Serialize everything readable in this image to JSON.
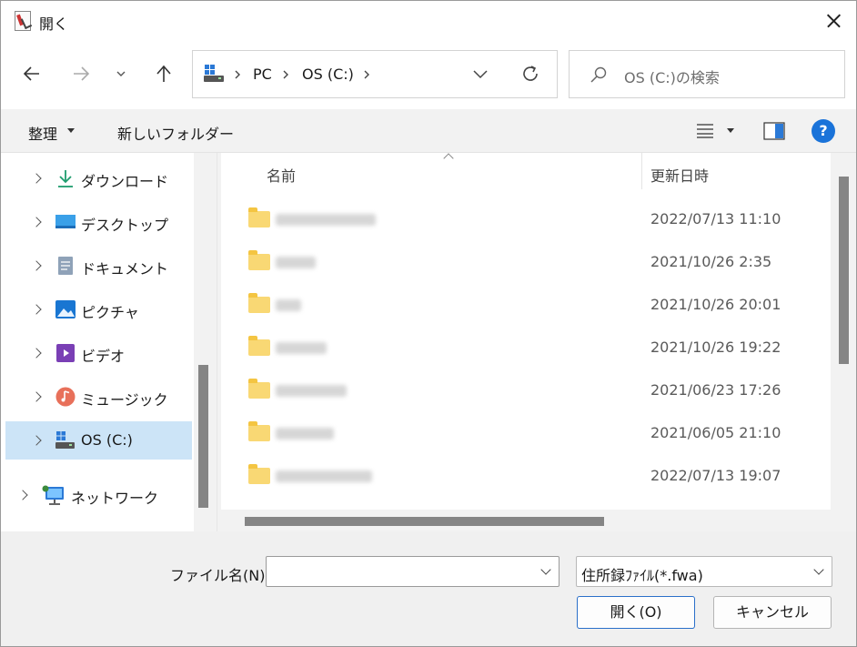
{
  "window": {
    "title": "開く"
  },
  "address": {
    "crumbs": [
      "PC",
      "OS (C:)"
    ]
  },
  "search": {
    "placeholder": "OS (C:)の検索"
  },
  "commands": {
    "organize": "整理",
    "new_folder": "新しいフォルダー"
  },
  "nav_pane": {
    "items": [
      {
        "label": "ダウンロード",
        "icon": "download-icon"
      },
      {
        "label": "デスクトップ",
        "icon": "desktop-icon"
      },
      {
        "label": "ドキュメント",
        "icon": "documents-icon"
      },
      {
        "label": "ピクチャ",
        "icon": "pictures-icon"
      },
      {
        "label": "ビデオ",
        "icon": "videos-icon"
      },
      {
        "label": "ミュージック",
        "icon": "music-icon"
      },
      {
        "label": "OS (C:)",
        "icon": "drive-icon",
        "selected": true
      },
      {
        "label": "ネットワーク",
        "icon": "network-icon"
      }
    ]
  },
  "file_list": {
    "columns": {
      "name": "名前",
      "date": "更新日時"
    },
    "rows": [
      {
        "date": "2022/07/13 11:10"
      },
      {
        "date": "2021/10/26 2:35"
      },
      {
        "date": "2021/10/26 20:01"
      },
      {
        "date": "2021/10/26 19:22"
      },
      {
        "date": "2021/06/23 17:26"
      },
      {
        "date": "2021/06/05 21:10"
      },
      {
        "date": "2022/07/13 19:07"
      }
    ]
  },
  "footer": {
    "filename_label": "ファイル名(N):",
    "filename_value": "",
    "file_type": "住所録ﾌｧｲﾙ(*.fwa)",
    "open_button": "開く(O)",
    "cancel_button": "キャンセル"
  },
  "colors": {
    "accent": "#1a73d9",
    "selected_bg": "#cce4f7",
    "folder": "#f9d874"
  }
}
